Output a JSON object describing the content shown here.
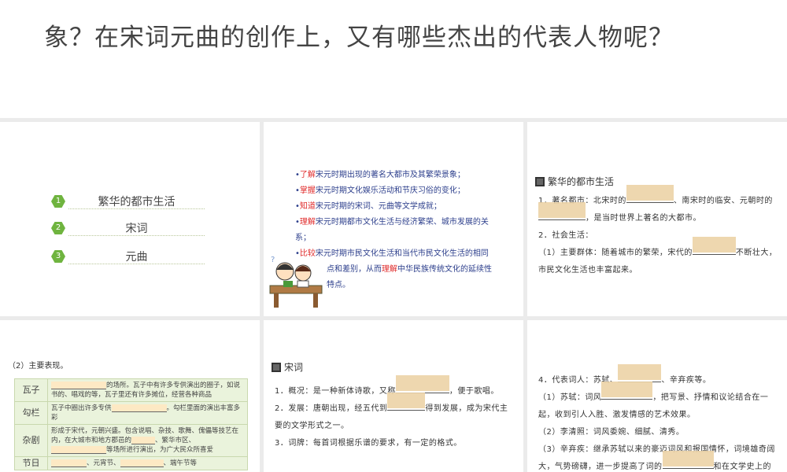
{
  "header": {
    "title": "象？在宋词元曲的创作上，又有哪些杰出的代表人物呢？"
  },
  "toc": {
    "items": [
      {
        "num": "1",
        "label": "繁华的都市生活"
      },
      {
        "num": "2",
        "label": "宋词"
      },
      {
        "num": "3",
        "label": "元曲"
      }
    ]
  },
  "goals": [
    {
      "key": "了解",
      "text": "宋元时期出现的著名大都市及其繁荣景象；"
    },
    {
      "key": "掌握",
      "text": "宋元时期文化娱乐活动和节庆习俗的变化；"
    },
    {
      "key": "知道",
      "text": "宋元时期的宋词、元曲等文学成就；"
    },
    {
      "key": "理解",
      "text": "宋元时期都市文化生活与经济繁荣、城市发展的关系；"
    },
    {
      "key": "比较",
      "text": "宋元时期市民文化生活和当代市民文化生活的相同",
      "cont1": "点和差别，从而",
      "key2": "理解",
      "cont2": "中华民族传统文化的延续性",
      "cont3": "特点。"
    }
  ],
  "city": {
    "heading": "繁华的都市生活",
    "l1a": "1．著名都市：北宋时的",
    "l1b": "、南宋时的临安、元朝时的",
    "l2": "，是当时世界上著名的大都市。",
    "l3": "2．社会生活：",
    "l4a": "（1）主要群体：随着城市的繁荣，宋代的",
    "l4b": "不断壮大，市民文化生活也丰富起来。"
  },
  "perf": {
    "heading": "（2）主要表现。",
    "rows": [
      {
        "name": "瓦子",
        "a": "",
        "b": "的场所。瓦子中有许多专供演出的圈子，如说书的、唱戏的等，瓦子里还有许多摊位，经营各种商品"
      },
      {
        "name": "勾栏",
        "a": "瓦子中圈出许多专供",
        "b": "。勾栏里面的演出丰富多彩"
      },
      {
        "name": "杂剧",
        "a": "形成于宋代，元朝兴盛。包含说唱、杂技、歌舞、傀儡等技艺在内，在大城市和地方郡邑的",
        "b": "、繁华市区、",
        "c": "等场所进行演出，为广大民众所喜爱"
      },
      {
        "name": "节日",
        "a": "、元宵节、",
        "b": "、端午节等"
      }
    ]
  },
  "songci": {
    "heading": "宋词",
    "l1a": "1．概况：是一种新体诗歌，又称",
    "l1b": "，便于歌唱。",
    "l2a": "2．发展：唐朝出现，经五代到",
    "l2b": "得到发展，成为宋代主要的文学形式之一。",
    "l3": "3．词牌：每首词根据乐谱的要求，有一定的格式。"
  },
  "poets": {
    "l1a": "4．代表词人：苏轼、",
    "l1b": "、辛弃疾等。",
    "l2a": "（1）苏轼：词风",
    "l2b": "，把写景、抒情和议论结合在一起，收到引人入胜、激发情感的艺术效果。",
    "l3": "（2）李清照：词风委婉、细腻、清秀。",
    "l4a": "（3）辛弃疾：继承苏轼以来的豪迈词风和报国情怀，词境雄奇阔大，气势磅礴，进一步提高了词的",
    "l4b": "和在文学史上的地位。"
  }
}
